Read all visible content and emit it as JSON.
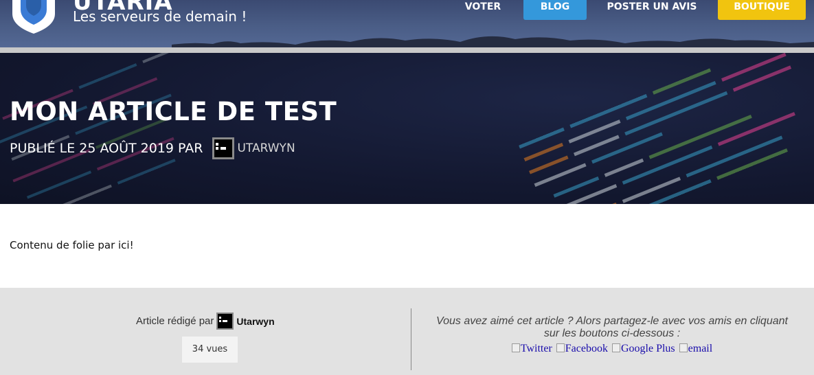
{
  "header": {
    "logo_title": "UTARIA",
    "logo_subtitle": "Les serveurs de demain !",
    "nav": {
      "voter": "VOTER",
      "blog": "BLOG",
      "poster": "POSTER UN AVIS",
      "boutique": "BOUTIQUE"
    }
  },
  "article": {
    "title": "MON ARTICLE DE TEST",
    "published": "PUBLIÉ LE 25 AOÛT 2019 PAR",
    "author": "UTARWYN",
    "content": "Contenu de folie par ici!"
  },
  "footer": {
    "written_by_label": "Article rédigé par",
    "author": "Utarwyn",
    "views": "34 vues",
    "share_text": "Vous avez aimé cet article ? Alors partagez-le avec vos amis en cliquant sur les boutons ci-dessous :",
    "share": {
      "twitter": "Twitter",
      "facebook": "Facebook",
      "google": "Google Plus",
      "email": "email"
    }
  },
  "colors": {
    "blog_button": "#3498db",
    "boutique_button": "#f1c40f",
    "hero_bg": "#131830",
    "footer_bg": "#e2e2e2",
    "link": "#1a0dab"
  }
}
